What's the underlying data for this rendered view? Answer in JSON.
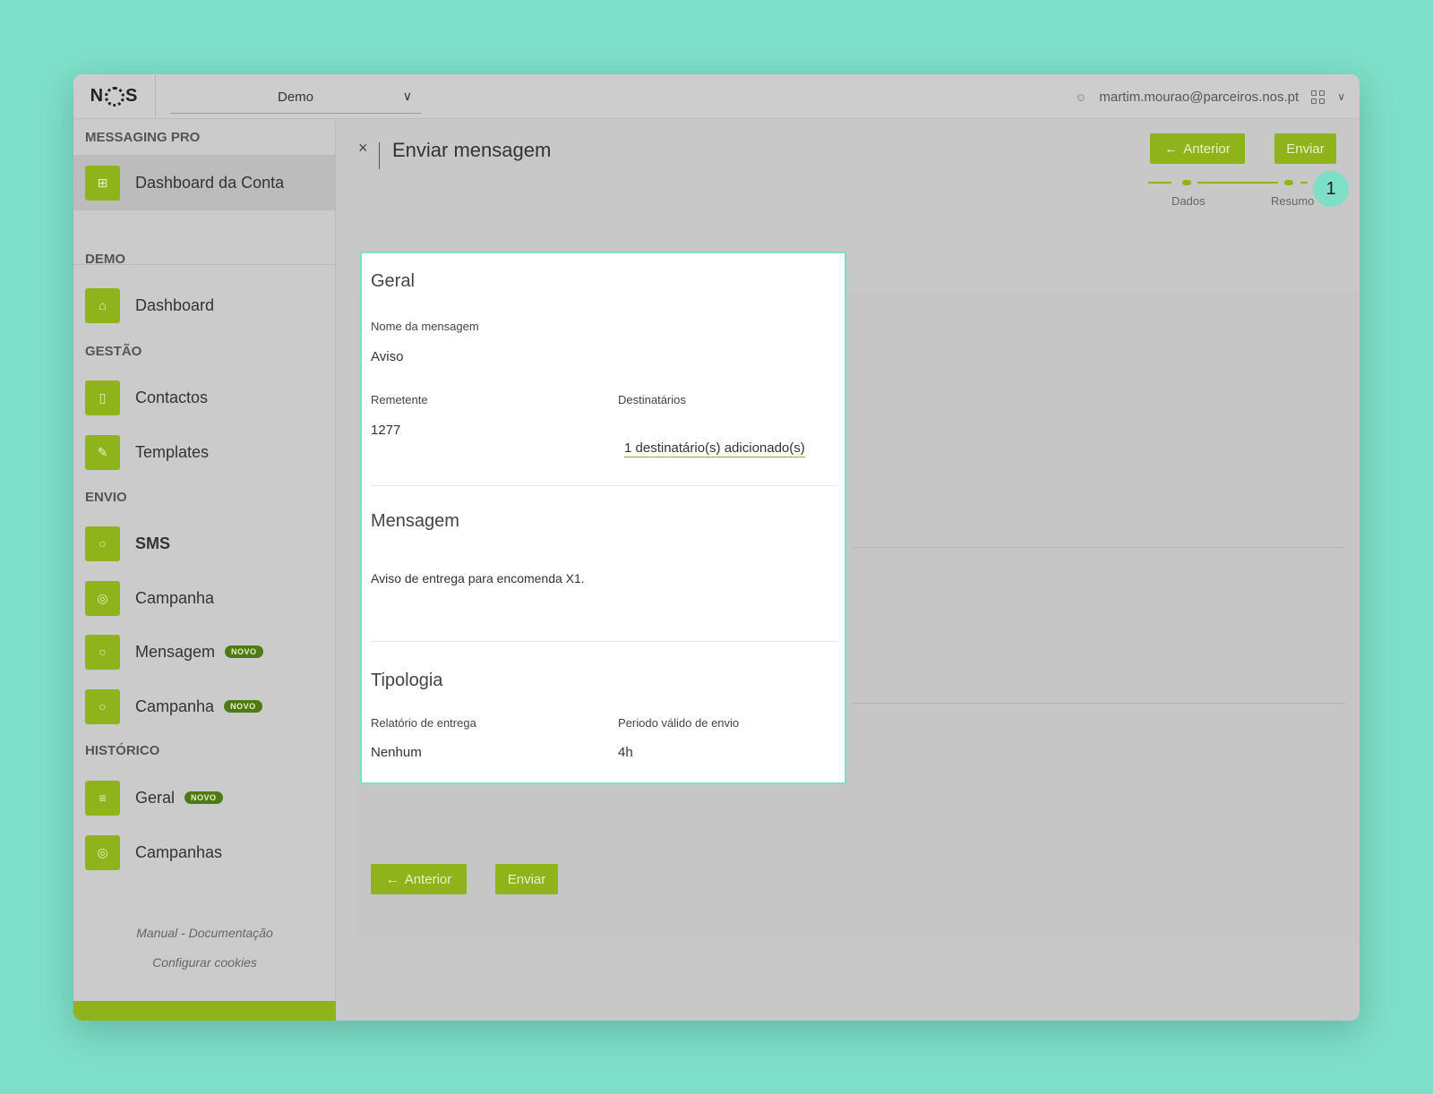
{
  "topbar": {
    "logo": "N",
    "logo_end": "S",
    "account": "Demo",
    "user_email": "martim.mourao@parceiros.nos.pt"
  },
  "sidebar": {
    "product": "MESSAGING PRO",
    "account_item": "Dashboard da Conta",
    "sections": {
      "demo": "DEMO",
      "gestao": "GESTÃO",
      "envio": "ENVIO",
      "historico": "HISTÓRICO"
    },
    "items": {
      "dashboard": "Dashboard",
      "contactos": "Contactos",
      "templates": "Templates",
      "sms": "SMS",
      "campanha": "Campanha",
      "mensagem": "Mensagem",
      "campanha_novo": "Campanha",
      "geral": "Geral",
      "campanhas": "Campanhas"
    },
    "badge_novo": "NOVO",
    "links": {
      "manual": "Manual - Documentação",
      "cookies": "Configurar cookies"
    }
  },
  "main": {
    "close": "×",
    "title": "Enviar mensagem",
    "btn_anterior": "Anterior",
    "btn_enviar": "Enviar",
    "steps": [
      "Dados",
      "Resumo"
    ],
    "step_badge": "1"
  },
  "card": {
    "geral": {
      "title": "Geral",
      "nome_label": "Nome da mensagem",
      "nome_value": "Aviso",
      "remetente_label": "Remetente",
      "remetente_value": "1277",
      "destinatarios_label": "Destinatários",
      "destinatarios_link": "1 destinatário(s) adicionado(s)"
    },
    "mensagem": {
      "title": "Mensagem",
      "text": "Aviso de entrega para encomenda X1."
    },
    "tipologia": {
      "title": "Tipologia",
      "relatorio_label": "Relatório de entrega",
      "relatorio_value": "Nenhum",
      "periodo_label": "Periodo válido de envio",
      "periodo_value": "4h"
    }
  },
  "colors": {
    "accent": "#8fb31a",
    "highlight": "#7ddfc6",
    "badge": "#4e7a14"
  }
}
